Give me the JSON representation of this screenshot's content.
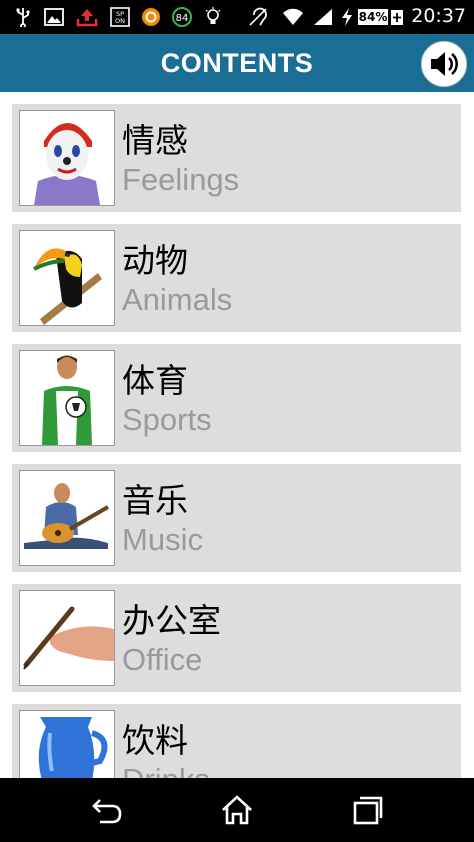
{
  "status_bar": {
    "time": "20:37",
    "battery": "84%",
    "icons": [
      "usb-icon",
      "image-icon",
      "upload-icon",
      "sim-icon",
      "circle-app-icon",
      "84-badge-icon",
      "lightbulb-icon",
      "hearing-icon",
      "wifi-icon",
      "signal-icon",
      "charging-icon",
      "battery-icon"
    ],
    "badge_value": "84"
  },
  "header": {
    "title": "CONTENTS",
    "sound_icon": "speaker-icon"
  },
  "categories": [
    {
      "zh": "情感",
      "en": "Feelings",
      "icon": "clown-face-image"
    },
    {
      "zh": "动物",
      "en": "Animals",
      "icon": "toucan-image"
    },
    {
      "zh": "体育",
      "en": "Sports",
      "icon": "soccer-player-image"
    },
    {
      "zh": "音乐",
      "en": "Music",
      "icon": "guitar-player-image"
    },
    {
      "zh": "办公室",
      "en": "Office",
      "icon": "hand-pen-image"
    },
    {
      "zh": "饮料",
      "en": "Drinks",
      "icon": "blue-jug-image"
    }
  ],
  "nav_bar": {
    "buttons": [
      "back-icon",
      "home-icon",
      "recents-icon"
    ]
  },
  "colors": {
    "header_bg": "#1a6e96",
    "row_bg": "#dddddd",
    "en_text": "#9a9a9a"
  }
}
